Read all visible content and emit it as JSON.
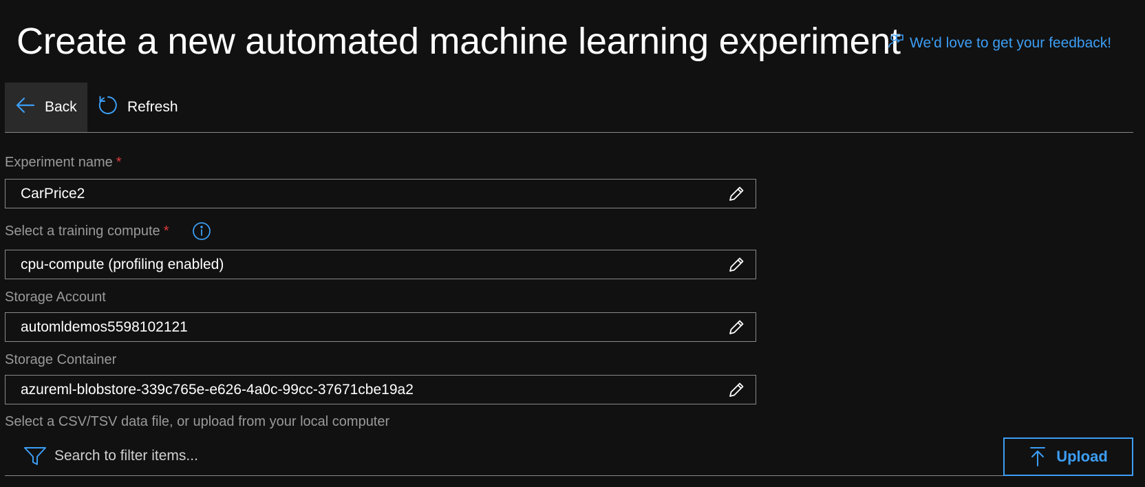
{
  "header": {
    "title": "Create a new automated machine learning experiment",
    "feedback_label": "We'd love to get your feedback!"
  },
  "toolbar": {
    "back_label": "Back",
    "refresh_label": "Refresh"
  },
  "form": {
    "experiment_name": {
      "label": "Experiment name",
      "required_mark": "*",
      "value": "CarPrice2"
    },
    "training_compute": {
      "label": "Select a training compute",
      "required_mark": "*",
      "value": "cpu-compute (profiling enabled)"
    },
    "storage_account": {
      "label": "Storage Account",
      "value": "automldemos5598102121"
    },
    "storage_container": {
      "label": "Storage Container",
      "value": "azureml-blobstore-339c765e-e626-4a0c-99cc-37671cbe19a2"
    },
    "data_file_label": "Select a CSV/TSV data file, or upload from your local computer"
  },
  "filter": {
    "placeholder": "Search to filter items..."
  },
  "upload_label": "Upload",
  "colors": {
    "background": "#111111",
    "accent": "#3c9ef5",
    "required": "#e0393e",
    "label": "#9a9a9a",
    "border": "#8a8a8a"
  },
  "icons": [
    "feedback-icon",
    "back-arrow-icon",
    "refresh-icon",
    "info-icon",
    "pencil-icon",
    "filter-icon",
    "upload-arrow-icon"
  ]
}
